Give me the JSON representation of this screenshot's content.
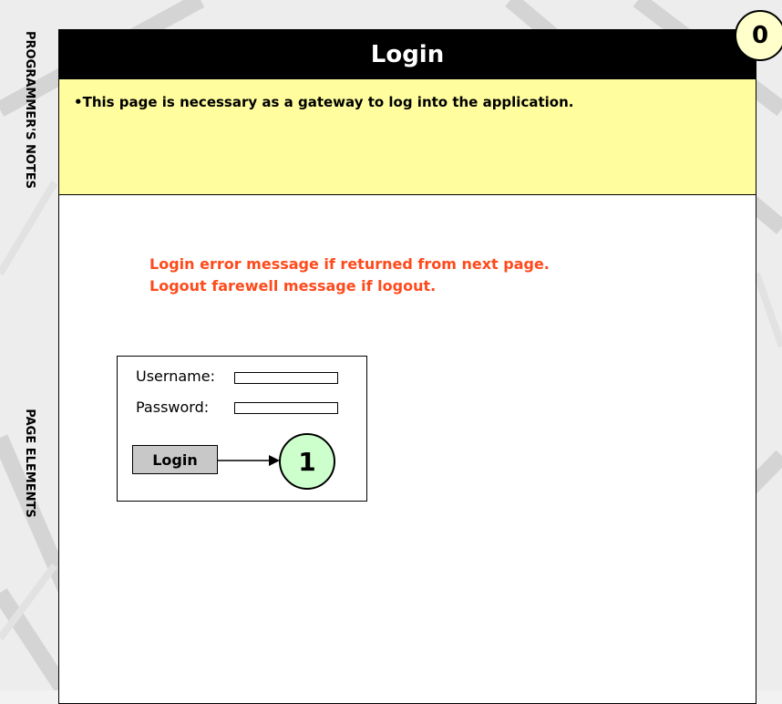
{
  "page": {
    "title": "Login",
    "page_number": "0"
  },
  "side_labels": {
    "notes": "PROGRAMMER'S NOTES",
    "elements": "PAGE ELEMENTS"
  },
  "notes": {
    "text": "•This page is necessary as a gateway to log into the application."
  },
  "messages": {
    "error": "Login error message if returned from next page.",
    "farewell": "Logout farewell message if logout."
  },
  "login_form": {
    "username_label": "Username:",
    "password_label": "Password:",
    "button_label": "Login",
    "callout_number": "1"
  },
  "colors": {
    "title_bar": "#000000",
    "notes_background": "#fffd9e",
    "message_text": "#ff4a1c",
    "page_badge": "#ffffcc",
    "callout_badge": "#ccffcc",
    "button": "#c8c8c8"
  }
}
